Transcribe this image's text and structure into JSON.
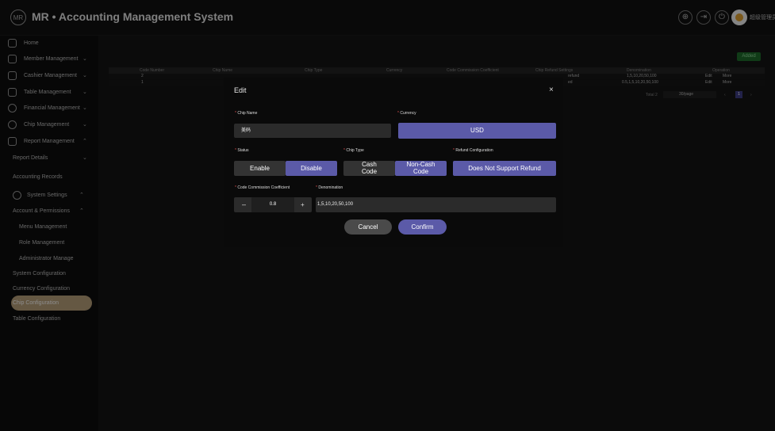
{
  "app": {
    "title": "MR • Accounting Management System",
    "user_name": "超级管理员"
  },
  "sidebar": {
    "items": [
      {
        "label": "Home"
      },
      {
        "label": "Member Management"
      },
      {
        "label": "Cashier Management"
      },
      {
        "label": "Table Management"
      },
      {
        "label": "Financial Management"
      },
      {
        "label": "Chip Management"
      },
      {
        "label": "Report Management"
      }
    ],
    "report_children": [
      {
        "label": "Report Details"
      },
      {
        "label": "Accounting Records"
      }
    ],
    "system_settings": {
      "label": "System Settings"
    },
    "account_permissions": {
      "label": "Account & Permissions"
    },
    "account_children": [
      {
        "label": "Menu Management"
      },
      {
        "label": "Role Management"
      },
      {
        "label": "Administrator Manage"
      }
    ],
    "config_items": [
      {
        "label": "System Configuration"
      },
      {
        "label": "Currency Configuration"
      },
      {
        "label": "Chip Configuration"
      },
      {
        "label": "Table Configuration"
      }
    ],
    "active": "Chip Configuration"
  },
  "table": {
    "add_label": "Added",
    "headers": [
      "Code Number",
      "Chip Name",
      "Chip Type",
      "Currency",
      "Code Commission Coefficient",
      "Chip Refund Settings",
      "Denomination",
      "Operation"
    ],
    "rows": [
      {
        "code": "2",
        "denomination": "1,5,10,20,50,100",
        "refund": "refund",
        "edit": "Edit",
        "more": "More"
      },
      {
        "code": "1",
        "denomination": "0.5,1,5,10,20,50,100",
        "refund": "ed",
        "edit": "Edit",
        "more": "More"
      }
    ],
    "pagination": {
      "total": "Total 2",
      "per_page": "30/page",
      "current": "1",
      "prev": "‹",
      "next": "›"
    }
  },
  "modal": {
    "title": "Edit",
    "close": "×",
    "chip_name": {
      "label": "Chip Name",
      "value": "美码"
    },
    "currency": {
      "label": "Currency",
      "value": "USD"
    },
    "status": {
      "label": "Status",
      "options": [
        "Enable",
        "Disable"
      ],
      "selected": "Disable"
    },
    "chip_type": {
      "label": "Chip Type",
      "options": [
        "Cash Code",
        "Non-Cash Code"
      ],
      "selected": "Non-Cash Code"
    },
    "refund": {
      "label": "Refund Configuration",
      "value": "Does Not Support Refund"
    },
    "commission": {
      "label": "Code Commission Coefficient",
      "value": "0.8",
      "minus": "–",
      "plus": "+"
    },
    "denomination": {
      "label": "Denomination",
      "value": "1,5,10,20,50,100"
    },
    "cancel": "Cancel",
    "confirm": "Confirm"
  },
  "colors": {
    "accent": "#5b5aa8",
    "active_menu": "#b9a07a",
    "add_button": "#1e6c2a"
  }
}
